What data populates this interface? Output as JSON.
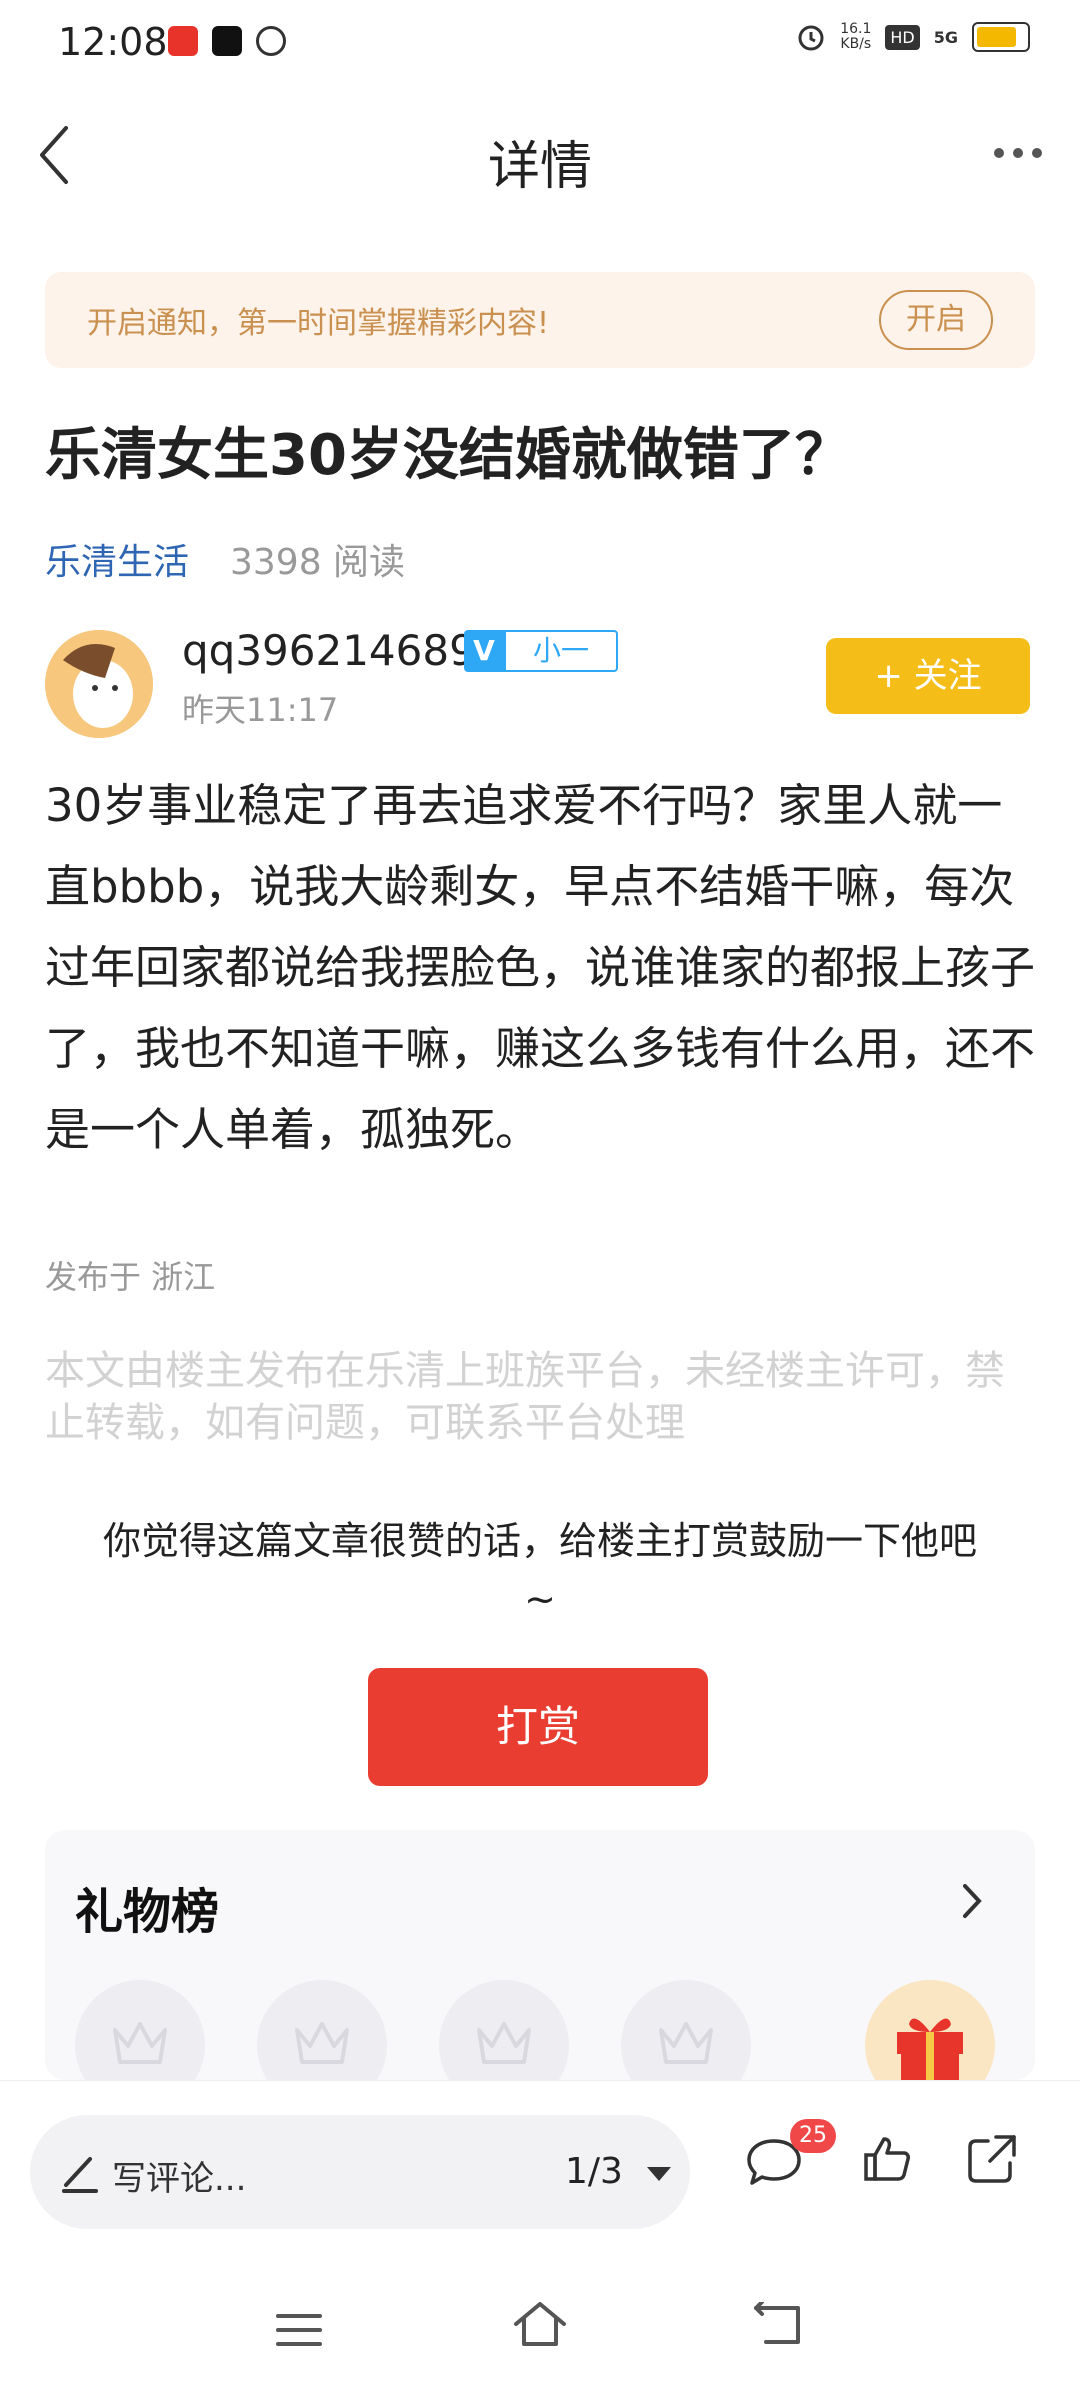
{
  "status_bar": {
    "time": "12:08",
    "net_speed_value": "16.1",
    "net_speed_unit": "KB/s",
    "hd_label": "HD",
    "signal_label": "5G",
    "battery_level": 0.85
  },
  "header": {
    "title": "详情"
  },
  "notify_banner": {
    "text": "开启通知，第一时间掌握精彩内容!",
    "button_label": "开启"
  },
  "article": {
    "title": "乐清女生30岁没结婚就做错了？",
    "channel": "乐清生活",
    "read_count": "3398 阅读",
    "author": {
      "name": "qq396214689",
      "badge_v": "V",
      "badge_level": "小一",
      "time": "昨天11:17"
    },
    "follow_label": "+ 关注",
    "body": "30岁事业稳定了再去追求爱不行吗？家里人就一直bbbb，说我大龄剩女，早点不结婚干嘛，每次过年回家都说给我摆脸色，说谁谁家的都报上孩子了，我也不知道干嘛，赚这么多钱有什么用，还不是一个人单着，孤独死。",
    "location": "发布于 浙江",
    "copyright": "本文由楼主发布在乐清上班族平台，未经楼主许可，禁止转载，如有问题，可联系平台处理"
  },
  "reward": {
    "prompt": "你觉得这篇文章很赞的话，给楼主打赏鼓励一下他吧~",
    "button_label": "打赏"
  },
  "gift_board": {
    "title": "礼物榜"
  },
  "bottom_bar": {
    "comment_placeholder": "写评论...",
    "pager": "1/3",
    "comment_count": "25"
  },
  "colors": {
    "accent_yellow": "#f5bd17",
    "reward_red": "#ea3d32",
    "channel_blue": "#2f66b3",
    "notify_brown": "#c9904f"
  }
}
